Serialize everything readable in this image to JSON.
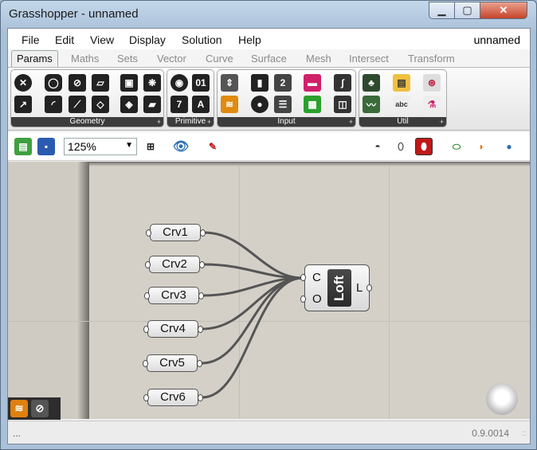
{
  "window": {
    "title": "Grasshopper - unnamed",
    "min_glyph": "▁",
    "max_glyph": "▢",
    "close_glyph": "✕"
  },
  "menu": {
    "items": [
      "File",
      "Edit",
      "View",
      "Display",
      "Solution",
      "Help"
    ],
    "doc_name": "unnamed"
  },
  "tabs": [
    "Params",
    "Maths",
    "Sets",
    "Vector",
    "Curve",
    "Surface",
    "Mesh",
    "Intersect",
    "Transform"
  ],
  "active_tab": "Params",
  "ribbon": {
    "panels": [
      {
        "label": "Geometry"
      },
      {
        "label": "Primitive"
      },
      {
        "label": "Input"
      },
      {
        "label": "Util"
      }
    ],
    "corner": "+"
  },
  "toolbar": {
    "zoom": "125%"
  },
  "canvas": {
    "params": [
      "Crv1",
      "Crv2",
      "Crv3",
      "Crv4",
      "Crv5",
      "Crv6"
    ],
    "loft": {
      "name": "Loft",
      "inputs": [
        "C",
        "O"
      ],
      "output": "L"
    }
  },
  "status": {
    "left": "...",
    "version": "0.9.0014",
    "grip": "::"
  },
  "colors": {
    "accent": "#c01818",
    "canvas": "#d4d0c8"
  }
}
